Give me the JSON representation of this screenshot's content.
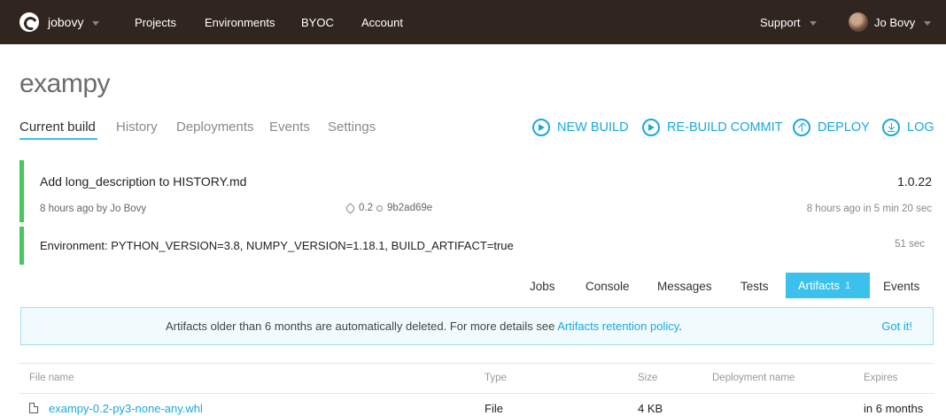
{
  "nav": {
    "account": "jobovy",
    "links": [
      "Projects",
      "Environments",
      "BYOC",
      "Account"
    ],
    "support": "Support",
    "user": "Jo Bovy"
  },
  "project": {
    "title": "exampy"
  },
  "subtabs": [
    "Current build",
    "History",
    "Deployments",
    "Events",
    "Settings"
  ],
  "actions": {
    "new_build": "NEW BUILD",
    "rebuild": "RE-BUILD COMMIT",
    "deploy": "DEPLOY",
    "log": "LOG"
  },
  "build": {
    "message": "Add long_description to HISTORY.md",
    "version": "1.0.22",
    "meta": "8 hours ago by Jo Bovy",
    "tag": "0.2",
    "commit": "9b2ad69e",
    "duration": "8 hours ago in 5 min 20 sec",
    "environment": "Environment: PYTHON_VERSION=3.8, NUMPY_VERSION=1.18.1, BUILD_ARTIFACT=true",
    "env_duration": "51 sec"
  },
  "job_tabs": {
    "jobs": "Jobs",
    "console": "Console",
    "messages": "Messages",
    "tests": "Tests",
    "artifacts": "Artifacts",
    "artifacts_count": "1",
    "events": "Events"
  },
  "notice": {
    "text": "Artifacts older than 6 months are automatically deleted. For more details see ",
    "link": "Artifacts retention policy",
    "period": ".",
    "dismiss": "Got it!"
  },
  "table": {
    "headers": {
      "file_name": "File name",
      "type": "Type",
      "size": "Size",
      "deployment": "Deployment name",
      "expires": "Expires"
    },
    "rows": [
      {
        "file_name": "exampy-0.2-py3-none-any.whl",
        "type": "File",
        "size": "4 KB",
        "deployment": "",
        "expires": "in 6 months"
      }
    ]
  },
  "colors": {
    "nav_bg": "#312520",
    "accent": "#1aa8de",
    "success": "#45c95a",
    "tab_active": "#3cc1ec"
  }
}
